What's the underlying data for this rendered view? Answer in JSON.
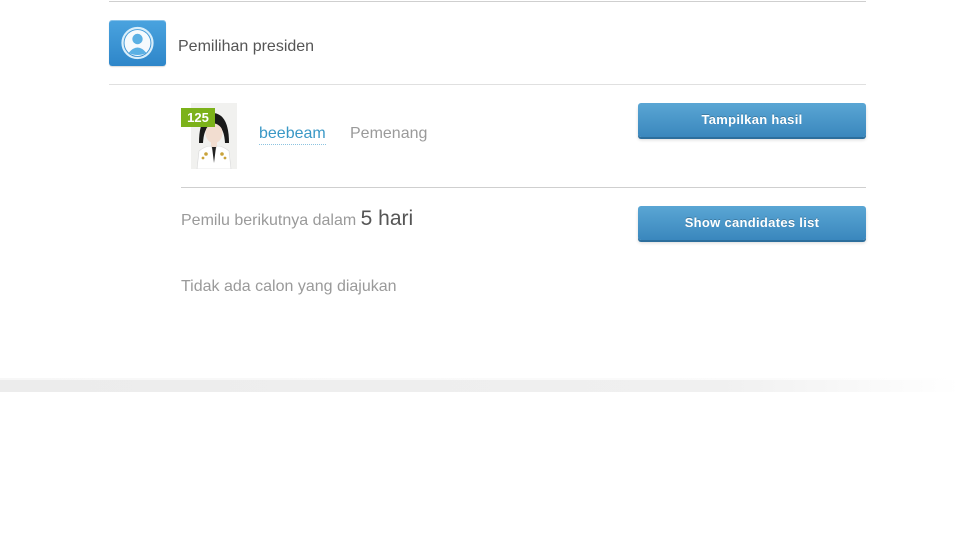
{
  "section": {
    "title": "Pemilihan presiden",
    "icon": "user-silhouette-icon"
  },
  "winner": {
    "level": "125",
    "username": "beebeam",
    "status": "Pemenang",
    "show_results_label": "Tampilkan hasil"
  },
  "next_election": {
    "prefix": "Pemilu berikutnya dalam",
    "days": "5 hari",
    "show_candidates_label": "Show candidates list"
  },
  "candidates": {
    "empty_text": "Tidak ada calon yang diajukan"
  },
  "colors": {
    "accent_button": "#4a98cc",
    "link": "#3a98c6",
    "level_badge": "#7cb21a",
    "icon_bg": "#3a94d4"
  }
}
